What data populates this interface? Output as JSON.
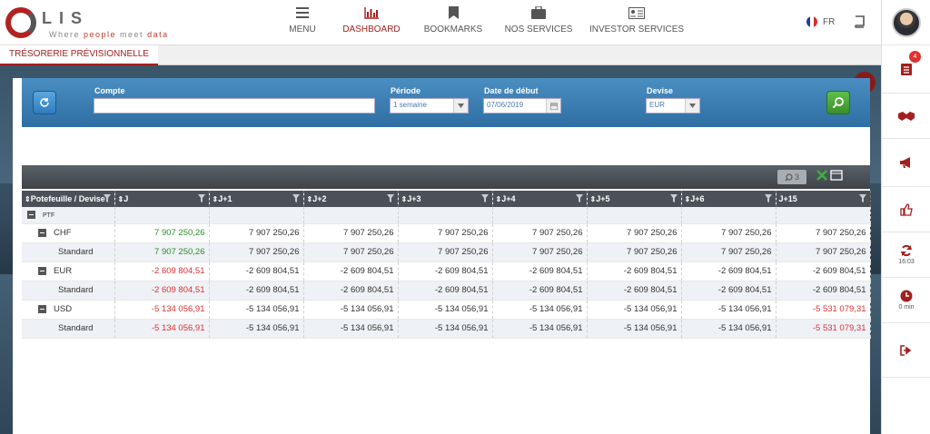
{
  "app": {
    "logo_text": "LIS",
    "tagline_prefix": "Where ",
    "tagline_accent": "people",
    "tagline_mid": " meet ",
    "tagline_accent2": "data"
  },
  "nav": [
    {
      "label": "MENU",
      "icon": "hamburger-icon"
    },
    {
      "label": "DASHBOARD",
      "icon": "bar-chart-icon",
      "active": true
    },
    {
      "label": "BOOKMARKS",
      "icon": "bookmark-icon"
    },
    {
      "label": "NOS SERVICES",
      "icon": "briefcase-icon"
    },
    {
      "label": "INVESTOR SERVICES",
      "icon": "id-card-icon"
    }
  ],
  "lang": "FR",
  "tab": "TRÉSORERIE PRÉVISIONNELLE",
  "filters": {
    "compte_label": "Compte",
    "compte_value": "",
    "periode_label": "Période",
    "periode_value": "1 semaine",
    "date_label": "Date de début",
    "date_value": "07/06/2019",
    "devise_label": "Devise",
    "devise_value": "EUR"
  },
  "toolbar": {
    "search_count": "3"
  },
  "columns": [
    "Potefeuille / Devise",
    "J",
    "J+1",
    "J+2",
    "J+3",
    "J+4",
    "J+5",
    "J+6",
    "J+15"
  ],
  "ptf_label": "PTF",
  "rows": [
    {
      "type": "group",
      "label": "CHF",
      "values": [
        "7 907 250,26",
        "7 907 250,26",
        "7 907 250,26",
        "7 907 250,26",
        "7 907 250,26",
        "7 907 250,26",
        "7 907 250,26",
        "7 907 250,26"
      ],
      "first_color": "green",
      "last_color": ""
    },
    {
      "type": "sub",
      "label": "Standard",
      "values": [
        "7 907 250,26",
        "7 907 250,26",
        "7 907 250,26",
        "7 907 250,26",
        "7 907 250,26",
        "7 907 250,26",
        "7 907 250,26",
        "7 907 250,26"
      ],
      "first_color": "green",
      "last_color": ""
    },
    {
      "type": "group",
      "label": "EUR",
      "values": [
        "-2 609 804,51",
        "-2 609 804,51",
        "-2 609 804,51",
        "-2 609 804,51",
        "-2 609 804,51",
        "-2 609 804,51",
        "-2 609 804,51",
        "-2 609 804,51"
      ],
      "first_color": "red",
      "last_color": ""
    },
    {
      "type": "sub",
      "label": "Standard",
      "values": [
        "-2 609 804,51",
        "-2 609 804,51",
        "-2 609 804,51",
        "-2 609 804,51",
        "-2 609 804,51",
        "-2 609 804,51",
        "-2 609 804,51",
        "-2 609 804,51"
      ],
      "first_color": "red",
      "last_color": ""
    },
    {
      "type": "group",
      "label": "USD",
      "values": [
        "-5 134 056,91",
        "-5 134 056,91",
        "-5 134 056,91",
        "-5 134 056,91",
        "-5 134 056,91",
        "-5 134 056,91",
        "-5 134 056,91",
        "-5 531 079,31"
      ],
      "first_color": "red",
      "last_color": "red"
    },
    {
      "type": "sub",
      "label": "Standard",
      "values": [
        "-5 134 056,91",
        "-5 134 056,91",
        "-5 134 056,91",
        "-5 134 056,91",
        "-5 134 056,91",
        "-5 134 056,91",
        "-5 134 056,91",
        "-5 531 079,31"
      ],
      "first_color": "red",
      "last_color": "red"
    }
  ],
  "sidebar": {
    "notifications": "4",
    "refresh_time": "16:03",
    "timer": "0 min"
  }
}
